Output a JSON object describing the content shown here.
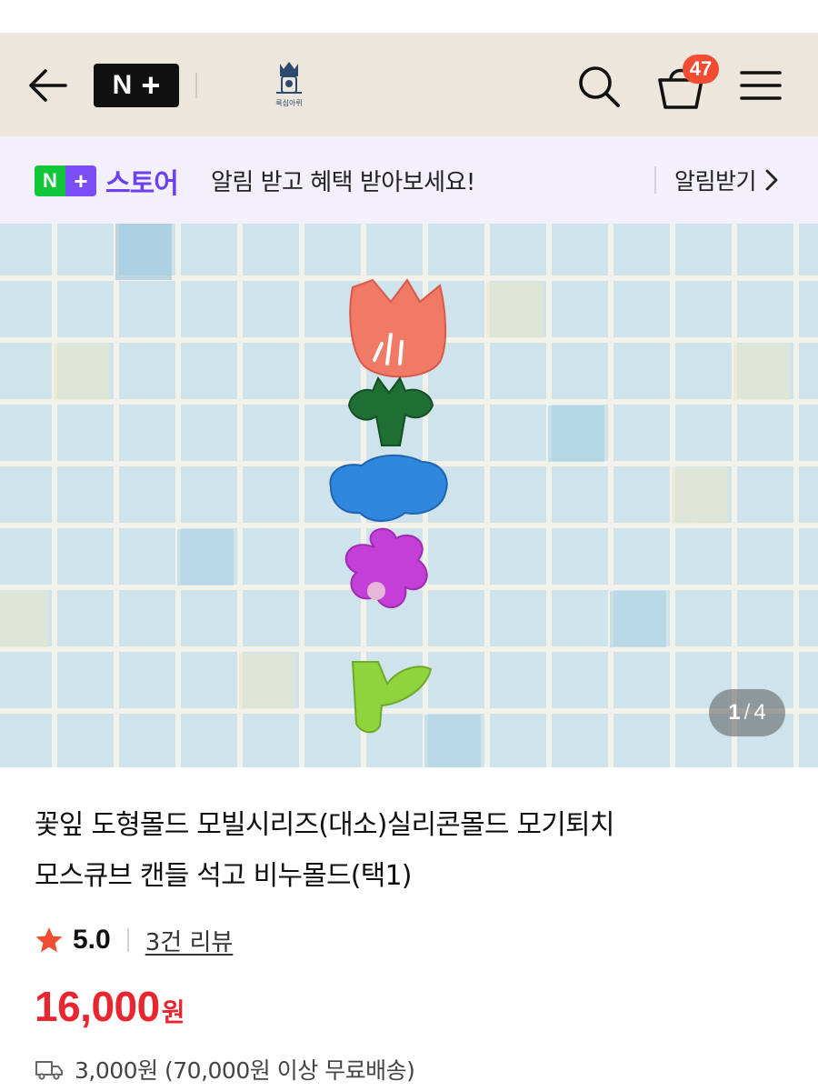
{
  "header": {
    "logo_n": "N",
    "logo_plus": "+",
    "brand_logo_text": "룩심아뤼",
    "cart_count": "47",
    "icons": {
      "back": "arrow-left-icon",
      "search": "search-icon",
      "cart": "shopping-basket-icon",
      "menu": "hamburger-menu-icon"
    }
  },
  "notice": {
    "badge_n": "N",
    "badge_plus": "+",
    "store_name": "스토어",
    "message": "알림 받고 혜택 받아보세요!",
    "action_label": "알림받기",
    "action_icon": "chevron-right-icon"
  },
  "gallery": {
    "current": "1",
    "separator": "/",
    "total": "4"
  },
  "product": {
    "title_line1": "꽃잎 도형몰드 모빌시리즈(대소)실리콘몰드 모기퇴치",
    "title_line2": "모스큐브 캔들 석고 비누몰드(택1)",
    "rating": "5.0",
    "review_link": "3건 리뷰",
    "price": "16,000",
    "price_unit": "원",
    "shipping": "3,000원 (70,000원 이상 무료배송)"
  },
  "colors": {
    "header_bg": "#ece6dd",
    "notice_bg": "#f3f0fb",
    "store_purple": "#6c3ff0",
    "naver_green": "#12c63a",
    "price_red": "#e8262f",
    "badge_red": "#f24c33"
  }
}
